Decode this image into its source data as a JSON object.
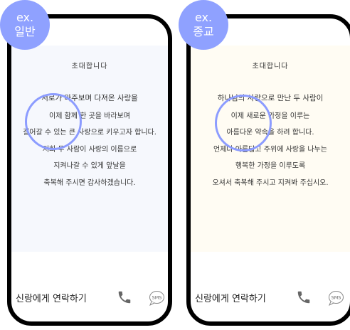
{
  "examples": [
    {
      "badge_line1": "ex.",
      "badge_line2": "일반",
      "title": "초대합니다",
      "lines": [
        "서로가 마주보며 다져온 사랑을",
        "이제 함께 한 곳을 바라보며",
        "걸어갈 수 있는 큰 사랑으로 키우고자 합니다.",
        "저희 두 사람이 사랑의 이름으로",
        "지켜나갈 수 있게 앞날을",
        "축복해 주시면 감사하겠습니다."
      ],
      "contact_label": "신랑에게 연락하기",
      "sms_label": "SMS",
      "background": "#f6f8fd"
    },
    {
      "badge_line1": "ex.",
      "badge_line2": "종교",
      "title": "초대합니다",
      "lines": [
        "하나님의 사랑으로 만난 두 사람이",
        "이제 새로운 가정을 이루는",
        "아름다운 약속을 하려 합니다.",
        "언제나 아름답고 주위에 사랑을 나누는",
        "행복한 가정을 이루도록",
        "오셔서 축복해 주시고 지켜봐 주십시오."
      ],
      "contact_label": "신랑에게 연락하기",
      "sms_label": "SMS",
      "background": "#fffcf3"
    }
  ],
  "accent": "#8fa1ff"
}
